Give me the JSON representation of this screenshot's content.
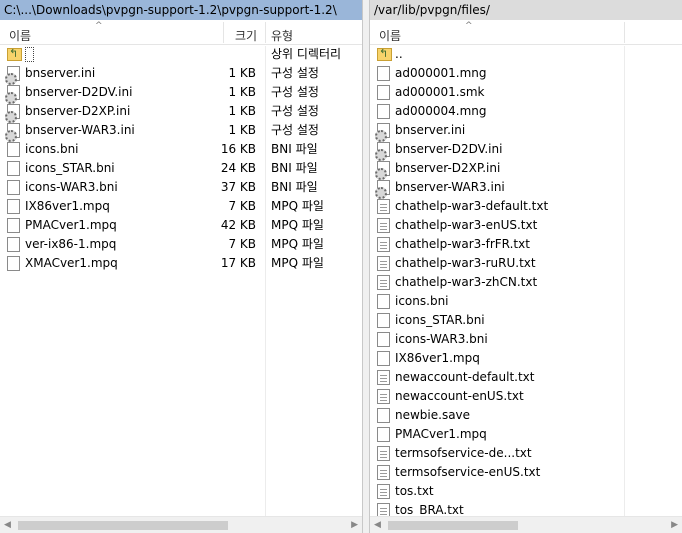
{
  "left_pane": {
    "path": "C:\\...\\Downloads\\pvpgn-support-1.2\\pvpgn-support-1.2\\",
    "columns": {
      "name": "이름",
      "size": "크기",
      "type": "유형"
    },
    "rows": [
      {
        "icon": "up-folder-icon",
        "name": "",
        "size": "",
        "type": "상위 디렉터리"
      },
      {
        "icon": "settings-file-icon",
        "name": "bnserver.ini",
        "size": "1 KB",
        "type": "구성 설정"
      },
      {
        "icon": "settings-file-icon",
        "name": "bnserver-D2DV.ini",
        "size": "1 KB",
        "type": "구성 설정"
      },
      {
        "icon": "settings-file-icon",
        "name": "bnserver-D2XP.ini",
        "size": "1 KB",
        "type": "구성 설정"
      },
      {
        "icon": "settings-file-icon",
        "name": "bnserver-WAR3.ini",
        "size": "1 KB",
        "type": "구성 설정"
      },
      {
        "icon": "file-icon",
        "name": "icons.bni",
        "size": "16 KB",
        "type": "BNI 파일"
      },
      {
        "icon": "file-icon",
        "name": "icons_STAR.bni",
        "size": "24 KB",
        "type": "BNI 파일"
      },
      {
        "icon": "file-icon",
        "name": "icons-WAR3.bni",
        "size": "37 KB",
        "type": "BNI 파일"
      },
      {
        "icon": "file-icon",
        "name": "IX86ver1.mpq",
        "size": "7 KB",
        "type": "MPQ 파일"
      },
      {
        "icon": "file-icon",
        "name": "PMACver1.mpq",
        "size": "42 KB",
        "type": "MPQ 파일"
      },
      {
        "icon": "file-icon",
        "name": "ver-ix86-1.mpq",
        "size": "7 KB",
        "type": "MPQ 파일"
      },
      {
        "icon": "file-icon",
        "name": "XMACver1.mpq",
        "size": "17 KB",
        "type": "MPQ 파일"
      }
    ]
  },
  "right_pane": {
    "path": "/var/lib/pvpgn/files/",
    "columns": {
      "name": "이름"
    },
    "rows": [
      {
        "icon": "up-folder-icon",
        "name": ".."
      },
      {
        "icon": "file-icon",
        "name": "ad000001.mng"
      },
      {
        "icon": "file-icon",
        "name": "ad000001.smk"
      },
      {
        "icon": "file-icon",
        "name": "ad000004.mng"
      },
      {
        "icon": "settings-file-icon",
        "name": "bnserver.ini"
      },
      {
        "icon": "settings-file-icon",
        "name": "bnserver-D2DV.ini"
      },
      {
        "icon": "settings-file-icon",
        "name": "bnserver-D2XP.ini"
      },
      {
        "icon": "settings-file-icon",
        "name": "bnserver-WAR3.ini"
      },
      {
        "icon": "text-file-icon",
        "name": "chathelp-war3-default.txt"
      },
      {
        "icon": "text-file-icon",
        "name": "chathelp-war3-enUS.txt"
      },
      {
        "icon": "text-file-icon",
        "name": "chathelp-war3-frFR.txt"
      },
      {
        "icon": "text-file-icon",
        "name": "chathelp-war3-ruRU.txt"
      },
      {
        "icon": "text-file-icon",
        "name": "chathelp-war3-zhCN.txt"
      },
      {
        "icon": "file-icon",
        "name": "icons.bni"
      },
      {
        "icon": "file-icon",
        "name": "icons_STAR.bni"
      },
      {
        "icon": "file-icon",
        "name": "icons-WAR3.bni"
      },
      {
        "icon": "file-icon",
        "name": "IX86ver1.mpq"
      },
      {
        "icon": "text-file-icon",
        "name": "newaccount-default.txt"
      },
      {
        "icon": "text-file-icon",
        "name": "newaccount-enUS.txt"
      },
      {
        "icon": "file-icon",
        "name": "newbie.save"
      },
      {
        "icon": "file-icon",
        "name": "PMACver1.mpq"
      },
      {
        "icon": "text-file-icon",
        "name": "termsofservice-de...txt"
      },
      {
        "icon": "text-file-icon",
        "name": "termsofservice-enUS.txt"
      },
      {
        "icon": "text-file-icon",
        "name": "tos.txt"
      },
      {
        "icon": "text-file-icon",
        "name": "tos_BRA.txt"
      }
    ]
  },
  "colors": {
    "left_path_bg": "#9ab6d9",
    "right_path_bg": "#dcdcdc",
    "up_folder": "#f7d36b"
  }
}
